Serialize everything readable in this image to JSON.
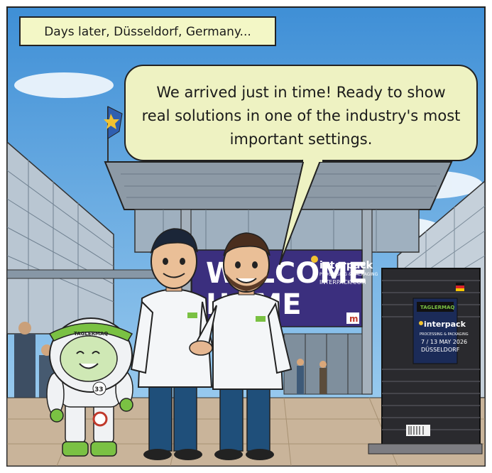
{
  "caption": {
    "text": "Days later, Düsseldorf, Germany..."
  },
  "speech_bubble": {
    "lines": [
      "We arrived just in time! Ready to show",
      "real solutions in one of the industry's most",
      "important settings."
    ]
  },
  "banner": {
    "welcome_line1": "WELCOME",
    "welcome_line2": "HOME",
    "brand": "interpack",
    "tagline": "PROCESSING & PACKAGING",
    "url": "INTERPACK.COM",
    "corner_mark": "m"
  },
  "crate": {
    "company": "TAGLERMAQ",
    "brand": "interpack",
    "tagline": "PROCESSING & PACKAGING",
    "dates": "7 / 13 MAY 2026",
    "city": "DÜSSELDORF"
  },
  "mascot": {
    "badge": "TAGLERMAQ",
    "number": "33"
  },
  "colors": {
    "sky": "#5ba8e0",
    "caption_bg": "#f3f7c6",
    "bubble_bg": "#eef2c2",
    "banner": "#3b2f7e",
    "brand_green": "#7ac143",
    "shirt": "#f4f6f8",
    "pants": "#1f4f7a"
  }
}
